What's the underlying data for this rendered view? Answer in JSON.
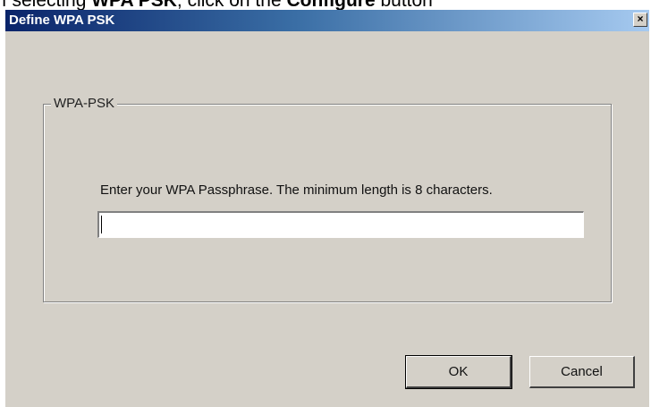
{
  "document_fragment": {
    "prefix": "If selecting ",
    "bold_1": "WPA PSK",
    "middle": ", click on the ",
    "bold_2": "Configure",
    "suffix": " button"
  },
  "window": {
    "title": "Define WPA PSK",
    "close_glyph": "×"
  },
  "group": {
    "legend": "WPA-PSK",
    "prompt": "Enter your WPA Passphrase.  The minimum length is 8 characters.",
    "passphrase_value": ""
  },
  "buttons": {
    "ok_label": "OK",
    "cancel_label": "Cancel"
  },
  "icons": {
    "close": "close-icon"
  },
  "colors": {
    "title_bar_start": "#0a246a",
    "title_bar_end": "#a6caf0",
    "dialog_face": "#d4d0c8"
  }
}
